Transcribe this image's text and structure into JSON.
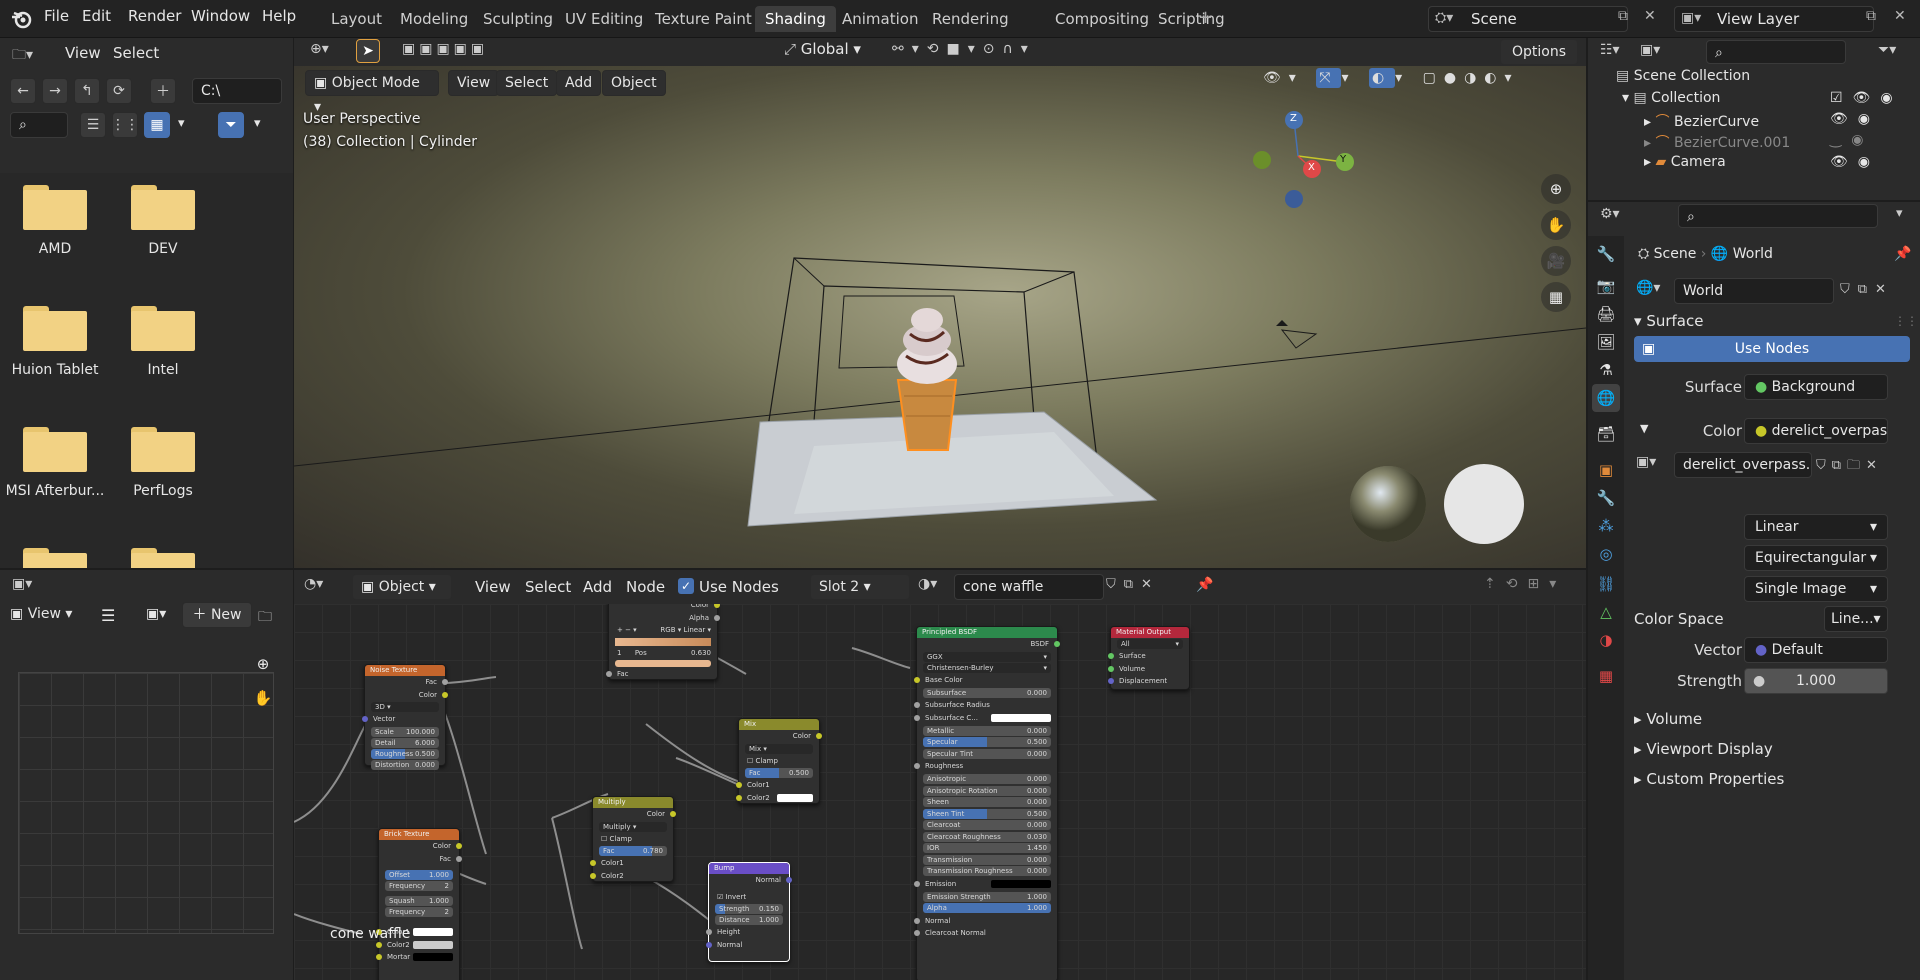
{
  "top_menu": {
    "file": "File",
    "edit": "Edit",
    "render": "Render",
    "window": "Window",
    "help": "Help"
  },
  "workspaces": [
    "Layout",
    "Modeling",
    "Sculpting",
    "UV Editing",
    "Texture Paint",
    "Shading",
    "Animation",
    "Rendering",
    "Compositing",
    "Scripting"
  ],
  "active_workspace": "Shading",
  "scene": {
    "name": "Scene",
    "view_layer": "View Layer"
  },
  "file_browser": {
    "menu_view": "View",
    "menu_select": "Select",
    "path": "C:\\",
    "folders": [
      "AMD",
      "DEV",
      "Huion Tablet",
      "Intel",
      "MSI Afterbur...",
      "PerfLogs"
    ]
  },
  "viewport": {
    "mode": "Object Mode",
    "menu": [
      "View",
      "Select",
      "Add",
      "Object"
    ],
    "orientation": "Global",
    "options": "Options",
    "overlay_line1": "User Perspective",
    "overlay_line2": "(38) Collection | Cylinder",
    "gizmo": {
      "x": "X",
      "y": "Y",
      "z": "Z"
    }
  },
  "node_editor": {
    "type": "Object",
    "menu": [
      "View",
      "Select",
      "Add",
      "Node"
    ],
    "use_nodes": "Use Nodes",
    "slot": "Slot 2",
    "material": "cone waffle",
    "frame_label": "cone waffle"
  },
  "nodes": {
    "color_ramp": {
      "color": "Color",
      "alpha": "Alpha",
      "mode": "RGB",
      "interp": "Linear",
      "index": "1",
      "pos_label": "Pos",
      "pos_value": "0.630",
      "fac": "Fac"
    },
    "noise": {
      "title": "Noise Texture",
      "fac": "Fac",
      "color": "Color",
      "dim": "3D",
      "vector": "Vector",
      "scale_l": "Scale",
      "scale_v": "100.000",
      "detail_l": "Detail",
      "detail_v": "6.000",
      "rough_l": "Roughness",
      "rough_v": "0.500",
      "dist_l": "Distortion",
      "dist_v": "0.000"
    },
    "mix": {
      "title": "Mix",
      "color": "Color",
      "mode": "Mix",
      "clamp": "Clamp",
      "fac_l": "Fac",
      "fac_v": "0.500",
      "c1": "Color1",
      "c2": "Color2"
    },
    "multiply": {
      "title": "Multiply",
      "color": "Color",
      "mode": "Multiply",
      "clamp": "Clamp",
      "fac_l": "Fac",
      "fac_v": "0.780",
      "c1": "Color1",
      "c2": "Color2"
    },
    "brick": {
      "title": "Brick Texture",
      "color": "Color",
      "fac": "Fac",
      "offset_l": "Offset",
      "offset_v": "1.000",
      "freq_l": "Frequency",
      "freq_v": "2",
      "squash_l": "Squash",
      "squash_v": "1.000",
      "freq2_l": "Frequency",
      "freq2_v": "2",
      "c1": "Color1",
      "c2": "Color2",
      "mortar": "Mortar"
    },
    "bump": {
      "title": "Bump",
      "normal": "Normal",
      "invert": "Invert",
      "strength_l": "Strength",
      "strength_v": "0.150",
      "distance_l": "Distance",
      "distance_v": "1.000",
      "height": "Height",
      "normal_in": "Normal"
    },
    "bsdf": {
      "title": "Principled BSDF",
      "out": "BSDF",
      "dist": "GGX",
      "sss": "Christensen-Burley",
      "base_color": "Base Color",
      "rows": [
        {
          "l": "Subsurface",
          "v": "0.000"
        },
        {
          "l": "Subsurface Radius",
          "v": ""
        },
        {
          "l": "Subsurface C...",
          "v": ""
        },
        {
          "l": "Metallic",
          "v": "0.000"
        },
        {
          "l": "Specular",
          "v": "0.500"
        },
        {
          "l": "Specular Tint",
          "v": "0.000"
        },
        {
          "l": "Roughness",
          "v": ""
        },
        {
          "l": "Anisotropic",
          "v": "0.000"
        },
        {
          "l": "Anisotropic Rotation",
          "v": "0.000"
        },
        {
          "l": "Sheen",
          "v": "0.000"
        },
        {
          "l": "Sheen Tint",
          "v": "0.500"
        },
        {
          "l": "Clearcoat",
          "v": "0.000"
        },
        {
          "l": "Clearcoat Roughness",
          "v": "0.030"
        },
        {
          "l": "IOR",
          "v": "1.450"
        },
        {
          "l": "Transmission",
          "v": "0.000"
        },
        {
          "l": "Transmission Roughness",
          "v": "0.000"
        },
        {
          "l": "Emission",
          "v": ""
        },
        {
          "l": "Emission Strength",
          "v": "1.000"
        },
        {
          "l": "Alpha",
          "v": "1.000"
        },
        {
          "l": "Normal",
          "v": ""
        },
        {
          "l": "Clearcoat Normal",
          "v": ""
        }
      ]
    },
    "output": {
      "title": "Material Output",
      "target": "All",
      "surface": "Surface",
      "volume": "Volume",
      "displacement": "Displacement"
    }
  },
  "image_editor": {
    "view": "View",
    "new": "New"
  },
  "outliner": {
    "root": "Scene Collection",
    "collection": "Collection",
    "items": [
      "BezierCurve",
      "BezierCurve.001",
      "Camera"
    ]
  },
  "properties": {
    "breadcrumb_scene": "Scene",
    "breadcrumb_world": "World",
    "world_name": "World",
    "surface_panel": "Surface",
    "use_nodes": "Use Nodes",
    "surface_label": "Surface",
    "surface_value": "Background",
    "color_label": "Color",
    "color_value": "derelict_overpas...",
    "image_name": "derelict_overpass...",
    "interpolation": "Linear",
    "projection": "Equirectangular",
    "source": "Single Image",
    "color_space_label": "Color Space",
    "color_space_value": "Line...",
    "vector_label": "Vector",
    "vector_value": "Default",
    "strength_label": "Strength",
    "strength_value": "1.000",
    "panels": [
      "Volume",
      "Viewport Display",
      "Custom Properties"
    ]
  },
  "colors": {
    "accent": "#4772b3",
    "bg": "#2b2b2b",
    "folder": "#f2d284",
    "selection": "#ff8f1f"
  }
}
